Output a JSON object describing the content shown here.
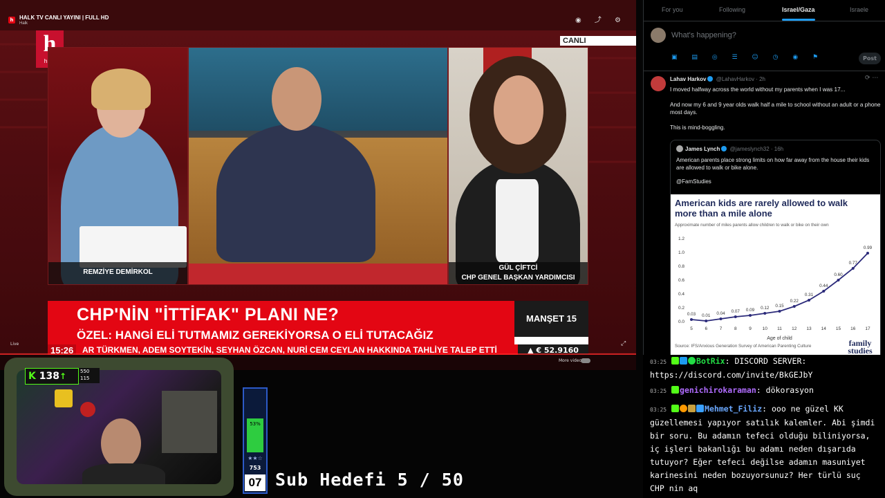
{
  "player": {
    "title": "HALK TV CANLI YAYINI | FULL HD",
    "channel": "Halk",
    "logo_letter": "h",
    "live_label": "Live",
    "more_videos": "More videos",
    "top_icons": "◉ ⤴ ⚙"
  },
  "broadcast": {
    "live_tag": "CANLI",
    "logo_text": "halk",
    "logo_letter": "h",
    "host_name": "REMZİYE DEMİRKOL",
    "guest_name": "GÜL ÇİFTCİ",
    "guest_title": "CHP GENEL BAŞKAN YARDIMCISI",
    "headline": "CHP'NİN \"İTTİFAK\" PLANI NE?",
    "subheadline": "ÖZEL: HANGİ ELİ TUTMAMIZ GEREKİYORSA O ELİ TUTACAĞIZ",
    "manset": "MANŞET 15",
    "ticker_time": "15:26",
    "ticker_text": "AR TÜRKMEN, ADEM SOYTEKİN, SEYHAN ÖZCAN, NURİ CEM CEYLAN HAKKINDA TAHLİYE TALEP ETTİ",
    "ticker_euro": "▲ € 52.9160"
  },
  "twitter": {
    "tabs": [
      {
        "label": "For you"
      },
      {
        "label": "Following"
      },
      {
        "label": "Israel/Gaza"
      },
      {
        "label": "Israele"
      }
    ],
    "compose_placeholder": "What's happening?",
    "compose_icons": "▣ ▤ ◎ ☰ ☺ ◷ ◉ ⚑",
    "post_label": "Post",
    "tweet": {
      "name": "Lahav Harkov",
      "handle": "@LahavHarkov · 2h",
      "lines": [
        "I moved halfway across the world without my parents when I was 17...",
        "And now my 6 and 9 year olds walk half a mile to school without an adult or a phone most days.",
        "This is mind-boggling."
      ],
      "quote": {
        "name": "James Lynch",
        "handle": "@jameslynch32 · 16h",
        "lines": [
          "American parents place strong limits on how far away from the house their kids are allowed to walk or bike alone.",
          "@FamStudies"
        ]
      }
    }
  },
  "chart_data": {
    "type": "line",
    "title": "American kids are rarely allowed to walk more than a mile alone",
    "subtitle": "Approximate number of miles parents allow children to walk or bike on their own",
    "xlabel": "Age of child",
    "ylabel": "",
    "x": [
      5,
      6,
      7,
      8,
      9,
      10,
      11,
      12,
      13,
      14,
      15,
      16,
      17
    ],
    "values": [
      0.03,
      0.01,
      0.04,
      0.07,
      0.09,
      0.12,
      0.15,
      0.22,
      0.31,
      0.44,
      0.6,
      0.77,
      0.99
    ],
    "value_labels": [
      "0.03",
      "0.01",
      "0.04",
      "0.07",
      "0.09",
      "0.12",
      "0.15",
      "0.22",
      "0.31",
      "0.44",
      "0.60",
      "0.77",
      "0.99"
    ],
    "yticks": [
      "0.0",
      "0.2",
      "0.4",
      "0.6",
      "0.8",
      "1.0",
      "1.2"
    ],
    "ylim": [
      0,
      1.2
    ],
    "grid": false,
    "line_color": "#2b2a7a",
    "source": "Source: IFS/Anxious Generation Survey of American Parenting Culture",
    "brand": "family studies"
  },
  "chat": {
    "messages": [
      {
        "time": "03:25",
        "user": "BotRix",
        "user_color": "#22dd44",
        "text": "DISCORD SERVER: https://discord.com/invite/BkGEJbY"
      },
      {
        "time": "03:25",
        "user": "genichirokaraman",
        "user_color": "#b06cff",
        "text": "dökorasyon"
      },
      {
        "time": "03:25",
        "user": "Mehmet_Filiz",
        "user_color": "#6aa8ff",
        "text": "ooo ne güzel KK güzellemesi yapıyor satılık kalemler. Abi şimdi bir soru. Bu adamın tefeci olduğu biliniyorsa, iç işleri bakanlığı bu adamı neden dışarıda tutuyor? Eğer tefeci değilse adamın masuniyet karinesini neden bozuyorsunuz? Her türlü suç CHP nin aq"
      }
    ]
  },
  "overlay": {
    "kick_logo": "K",
    "kick_count": "138",
    "kick_arrow": "↑",
    "stat_a": "550",
    "stat_b": "115",
    "meter_percent": "53%",
    "meter_fraction": 0.53,
    "meter_stars": "★★☆",
    "meter_count": "753",
    "meter_big": "07",
    "sub_goal": "Sub Hedefi 5 / 50"
  },
  "colors": {
    "accent_red": "#e30613",
    "twitter_blue": "#1d9bf0",
    "kick_green": "#53fc18"
  }
}
